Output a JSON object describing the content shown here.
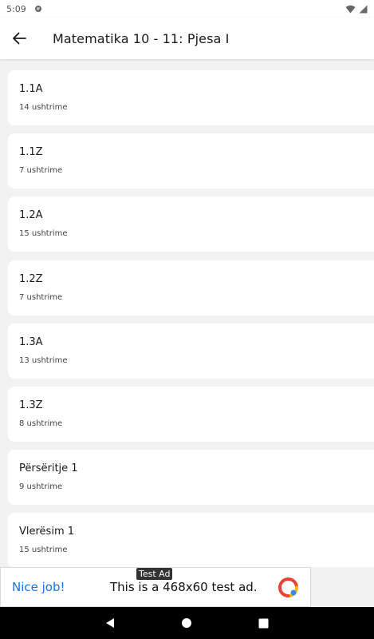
{
  "status_bar": {
    "time": "5:09"
  },
  "app_bar": {
    "title": "Matematika 10 - 11: Pjesa I"
  },
  "list": {
    "items": [
      {
        "title": "1.1A",
        "subtitle": "14 ushtrime"
      },
      {
        "title": "1.1Z",
        "subtitle": "7 ushtrime"
      },
      {
        "title": "1.2A",
        "subtitle": "15 ushtrime"
      },
      {
        "title": "1.2Z",
        "subtitle": "7 ushtrime"
      },
      {
        "title": "1.3A",
        "subtitle": "13 ushtrime"
      },
      {
        "title": "1.3Z",
        "subtitle": "8 ushtrime"
      },
      {
        "title": "Përsëritje 1",
        "subtitle": "9 ushtrime"
      },
      {
        "title": "Vlerësim 1",
        "subtitle": "15 ushtrime"
      }
    ]
  },
  "ad": {
    "tag": "Test Ad",
    "cta": "Nice job!",
    "text": "This is a 468x60 test ad."
  },
  "colors": {
    "accent": "#1a73e8",
    "background": "#f2f2f2",
    "card": "#ffffff"
  }
}
